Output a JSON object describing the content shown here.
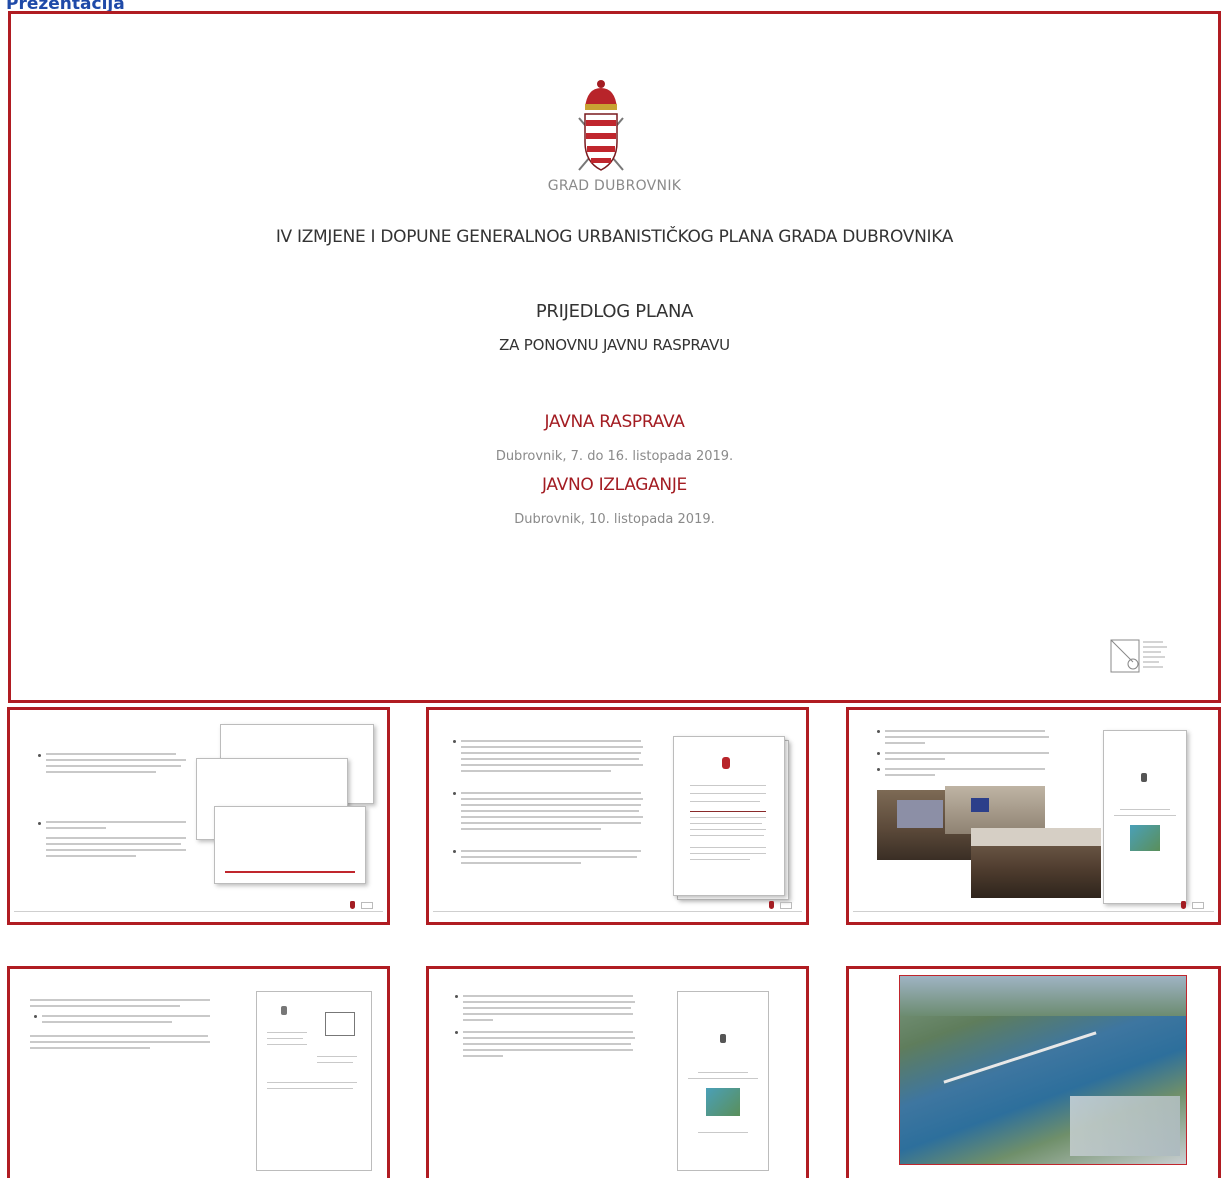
{
  "page": {
    "heading": "Prezentacija"
  },
  "main_slide": {
    "city": "GRAD DUBROVNIK",
    "plan_title": "IV IZMJENE I DOPUNE GENERALNOG URBANISTIČKOG PLANA GRADA DUBROVNIKA",
    "proposal": "PRIJEDLOG PLANA",
    "subtitle": "ZA PONOVNU JAVNU RASPRAVU",
    "event1_title": "JAVNA RASPRAVA",
    "event1_date": "Dubrovnik, 7. do 16. listopada 2019.",
    "event2_title": "JAVNO IZLAGANJE",
    "event2_date": "Dubrovnik, 10. listopada 2019.",
    "colors": {
      "accent_red": "#a31c22",
      "frame_red": "#b01c22",
      "heading_blue": "#1f4aa8",
      "grey_text": "#8a8a8a"
    },
    "icons": [
      "coat-of-arms-icon",
      "institute-logo-icon"
    ]
  }
}
